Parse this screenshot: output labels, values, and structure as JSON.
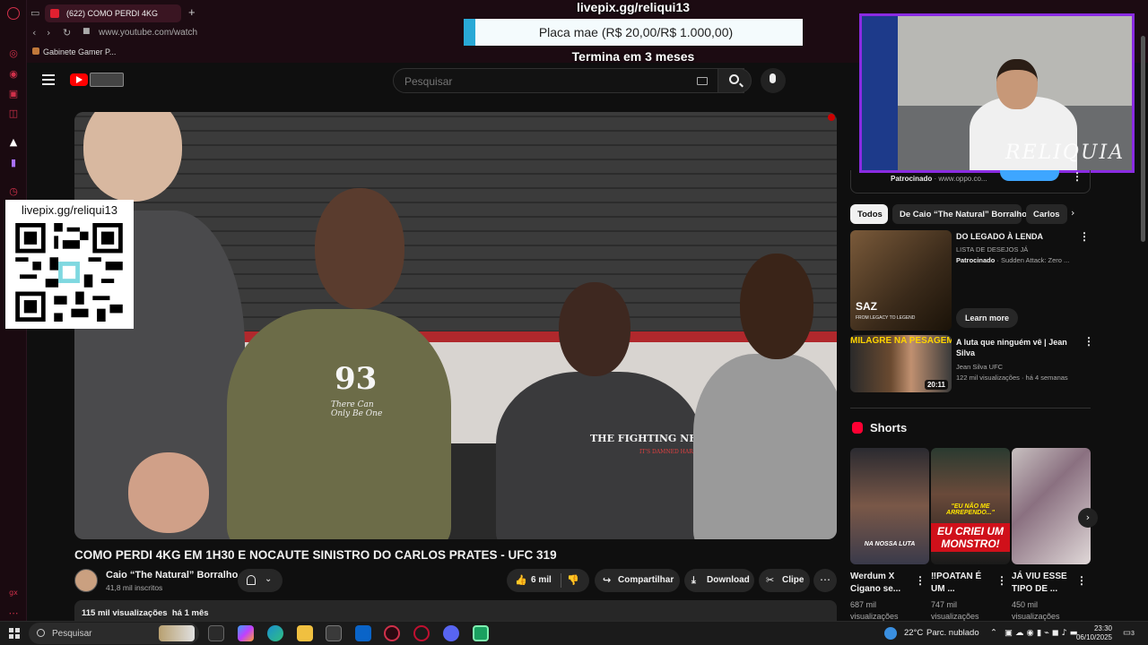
{
  "browser": {
    "tab_title": "(622) COMO PERDI 4KG",
    "url": "www.youtube.com/watch",
    "bookmark": "Gabinete Gamer P...",
    "new_tab_icon": "plus-icon"
  },
  "youtube": {
    "search_placeholder": "Pesquisar",
    "video": {
      "title": "COMO PERDI 4KG EM 1H30 E NOCAUTE SINISTRO DO CARLOS PRATES - UFC 319",
      "shirt_number": "93",
      "shirt_script": "There Can Only Be One",
      "shirt_brand": "THE FIGHTING NERDS",
      "shirt_tagline": "IT'S DAMNED HARD"
    },
    "channel": {
      "name": "Caio “The Natural” Borralho",
      "subscribers": "41,8 mil inscritos"
    },
    "actions": {
      "likes": "6 mil",
      "share": "Compartilhar",
      "download": "Download",
      "clip": "Clipe"
    },
    "description": {
      "views": "115 mil visualizações",
      "age": "há 1 mês"
    },
    "sponsor_row": {
      "label": "Patrocinado",
      "domain": "www.oppo.co..."
    },
    "chips": [
      "Todos",
      "De Caio “The Natural” Borralho",
      "Carlos"
    ],
    "ad": {
      "title": "DO LEGADO À LENDA",
      "subtitle": "LISTA DE DESEJOS JÁ",
      "sponsored": "Patrocinado",
      "advertiser": "Sudden Attack: Zero ...",
      "cta": "Learn more",
      "thumb_logo": "SAZ",
      "thumb_tagline": "FROM LEGACY TO LEGEND"
    },
    "recommended": [
      {
        "title": "A luta que ninguém vê | Jean Silva",
        "channel": "Jean Silva UFC",
        "views": "122 mil visualizações",
        "age": "há 4 semanas",
        "duration": "20:11",
        "thumb_text": "MILAGRE NA PESAGEM"
      }
    ],
    "shorts": {
      "heading": "Shorts",
      "items": [
        {
          "title": "Werdum X Cigano se...",
          "views": "687 mil visualizações",
          "caption": "NA NOSSA LUTA"
        },
        {
          "title": "‼POATAN É UM ...",
          "views": "747 mil visualizações",
          "caption": "EU CRIEI UM MONSTRO!",
          "caption_top": "\"EU NÃO ME ARREPENDO...\""
        },
        {
          "title": "JÁ VIU ESSE TIPO DE ...",
          "views": "450 mil visualizações",
          "caption": ""
        }
      ]
    }
  },
  "overlay": {
    "qr_label": "livepix.gg/reliqui13",
    "goal_url": "livepix.gg/reliqui13",
    "goal_text": "Placa mae (R$ 20,00/R$ 1.000,00)",
    "goal_progress": 0.02,
    "goal_ends": "Termina em 3 meses",
    "webcam_label": "RELIQUIA"
  },
  "taskbar": {
    "search_placeholder": "Pesquisar",
    "temperature": "22°C",
    "weather": "Parc. nublado",
    "time": "23:30",
    "date": "06/10/2025",
    "notifications": "3"
  },
  "colors": {
    "youtube_red": "#ff0000",
    "goal_blue": "#29a9d6",
    "webcam_border": "#8a2be2",
    "opera_red": "#d0304a"
  }
}
